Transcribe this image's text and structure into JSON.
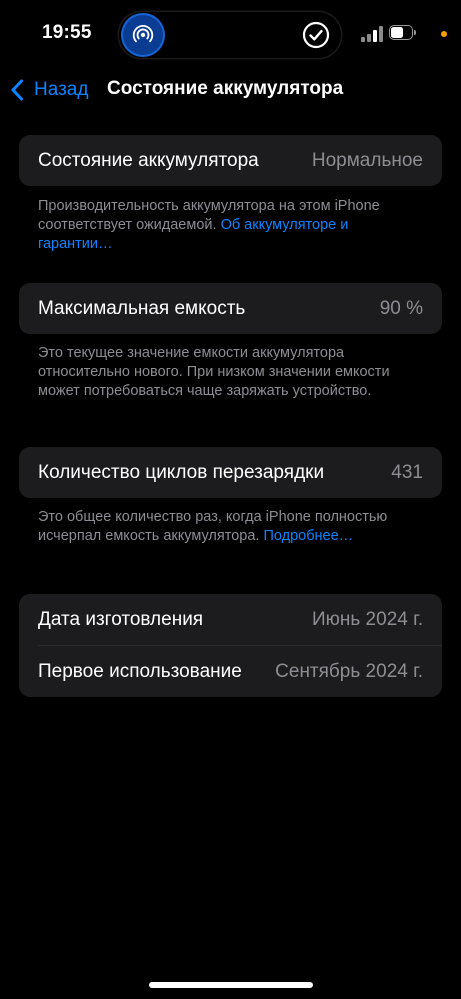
{
  "status_bar": {
    "time": "19:55",
    "left_island_icon": "airdrop-icon",
    "right_island_icon": "checkmark-circle-icon",
    "battery_level": 0.65,
    "privacy_dot_color": "#ff9f0a"
  },
  "nav": {
    "back_label": "Назад",
    "title": "Состояние аккумулятора"
  },
  "sections": {
    "health": {
      "label": "Состояние аккумулятора",
      "value": "Нормальное",
      "footer_text": "Производительность аккумулятора на этом iPhone соответствует ожидаемой. ",
      "footer_link": "Об аккумуляторе и гарантии…"
    },
    "capacity": {
      "label": "Максимальная емкость",
      "value": "90 %",
      "footer_text": "Это текущее значение емкости аккумулятора относительно нового. При низком значении емкости может потребоваться чаще заряжать устройство."
    },
    "cycles": {
      "label": "Количество циклов перезарядки",
      "value": "431",
      "footer_text": "Это общее количество раз, когда iPhone полностью исчерпал емкость аккумулятора. ",
      "footer_link": "Подробнее…"
    },
    "dates": {
      "manufacture_label": "Дата изготовления",
      "manufacture_value": "Июнь 2024 г.",
      "first_use_label": "Первое использование",
      "first_use_value": "Сентябрь 2024 г."
    }
  },
  "colors": {
    "accent": "#0a84ff",
    "card_bg": "#1c1c1e",
    "secondary_text": "#8d8d93"
  }
}
